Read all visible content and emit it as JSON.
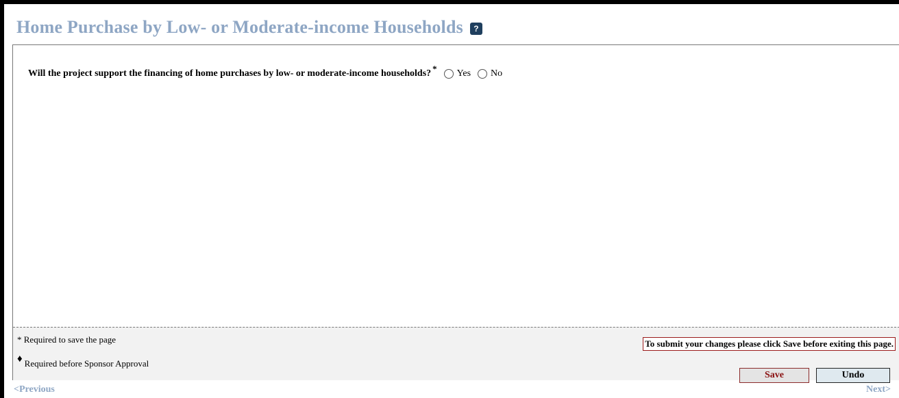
{
  "header": {
    "title": "Home Purchase by Low- or Moderate-income Households",
    "help_icon": "?"
  },
  "form": {
    "question": "Will the project support the financing of home purchases by low- or moderate-income households?",
    "required_marker": "*",
    "options": [
      {
        "label": "Yes",
        "selected": false
      },
      {
        "label": "No",
        "selected": false
      }
    ]
  },
  "footer": {
    "legend_required_save": "* Required to save the page",
    "legend_required_approval_symbol": "♦",
    "legend_required_approval": "Required before Sponsor Approval",
    "notice": "To submit your changes please click Save before exiting this page.",
    "save_label": "Save",
    "undo_label": "Undo"
  },
  "nav": {
    "previous": "<Previous",
    "next": "Next>"
  },
  "colors": {
    "title": "#8ea6c4",
    "help_icon_bg": "#1f3f5e",
    "notice_border": "#9b1b1b",
    "save_text": "#8a1010",
    "undo_bg": "#dfe9ef"
  }
}
